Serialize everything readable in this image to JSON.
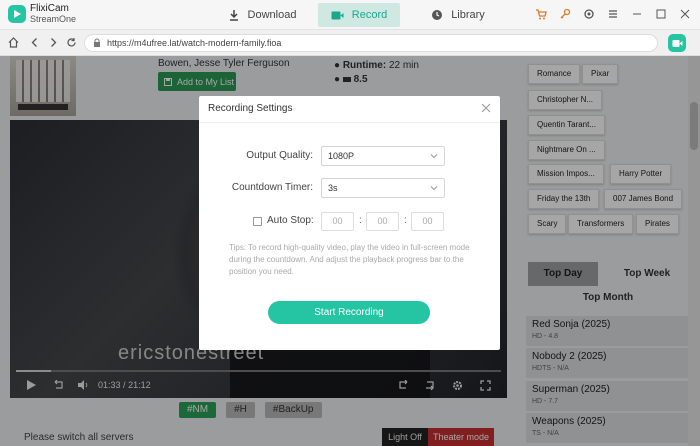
{
  "app": {
    "name": "FlixiCam",
    "subname": "StreamOne"
  },
  "tabs": {
    "download": "Download",
    "record": "Record",
    "library": "Library"
  },
  "address": {
    "url": "https://m4ufree.lat/watch-modern-family.fioa"
  },
  "movie": {
    "cast_line": "Bowen, Jesse Tyler Ferguson",
    "add_button": "Add to My List",
    "runtime_label": "Runtime:",
    "runtime_value": "22 min",
    "rating": "8.5"
  },
  "player": {
    "watermark": "ericstonestreet",
    "current_time": "01:33",
    "separator": "/",
    "total_time": "21:12",
    "progress_fraction": 0.073
  },
  "servers": {
    "nm": "#NM",
    "h": "#H",
    "backup": "#BackUp"
  },
  "switch_text": "Please switch all servers",
  "light_off": "Light Off",
  "theater_mode": "Theater mode",
  "genres": [
    "Romance",
    "Pixar",
    "Christopher N...",
    "Quentin Tarant...",
    "Nightmare On ...",
    "Mission Impos...",
    "Harry Potter",
    "Friday the 13th",
    "007 James Bond",
    "Scary",
    "Transformers",
    "Pirates"
  ],
  "top": {
    "day": "Top Day",
    "week": "Top Week",
    "month": "Top Month"
  },
  "top_movies": [
    {
      "title": "Red Sonja (2025)",
      "sub": "HD - 4.8"
    },
    {
      "title": "Nobody 2 (2025)",
      "sub": "HDTS - N/A"
    },
    {
      "title": "Superman (2025)",
      "sub": "HD - 7.7"
    },
    {
      "title": "Weapons (2025)",
      "sub": "TS - N/A"
    }
  ],
  "modal": {
    "title": "Recording Settings",
    "quality_label": "Output Quality:",
    "quality_value": "1080P",
    "countdown_label": "Countdown Timer:",
    "countdown_value": "3s",
    "autostop_label": "Auto Stop:",
    "hh": "00",
    "mm": "00",
    "ss": "00",
    "colon": ":",
    "tips": "Tips: To record high-quality video, play the video in full-screen mode during the countdown. And adjust the playback progress bar to the position you need.",
    "start_button": "Start Recording"
  },
  "colors": {
    "accent": "#25c5a3",
    "nm_server": "#2aa05a",
    "theater": "#c43132"
  }
}
